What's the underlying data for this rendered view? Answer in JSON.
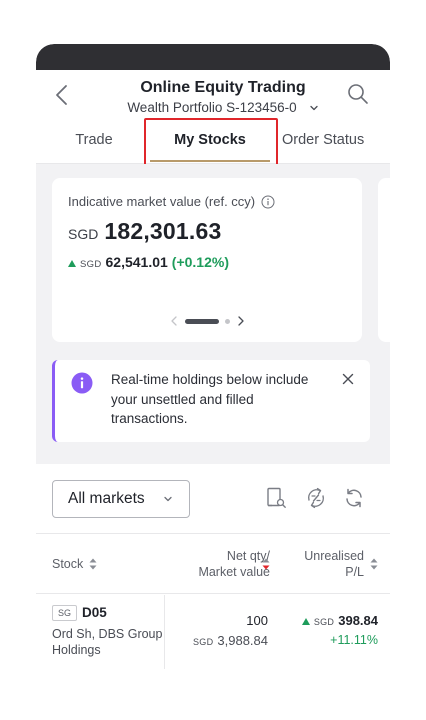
{
  "header": {
    "title": "Online Equity Trading",
    "account": "Wealth Portfolio S-123456-0"
  },
  "tabs": [
    {
      "label": "Trade",
      "active": false
    },
    {
      "label": "My Stocks",
      "active": true
    },
    {
      "label": "Order Status",
      "active": false
    }
  ],
  "market_value": {
    "label": "Indicative market value (ref. ccy)",
    "currency": "SGD",
    "value": "182,301.63",
    "change_currency": "SGD",
    "change": "62,541.01",
    "change_pct": "(+0.12%)",
    "change_direction": "up"
  },
  "notice": {
    "text": "Real-time holdings below include your unsettled and filled transactions.",
    "accent_color": "#8a5cf5"
  },
  "filters": {
    "market": "All markets"
  },
  "table": {
    "headers": {
      "stock": "Stock",
      "net_qty": "Net qty/",
      "market_value": "Market value",
      "unrealised": "Unrealised",
      "pl": "P/L"
    },
    "rows": [
      {
        "market": "SG",
        "symbol": "D05",
        "name": "Ord Sh, DBS Group Holdings",
        "qty": "100",
        "mv_currency": "SGD",
        "market_value": "3,988.84",
        "upl_currency": "SGD",
        "upl": "398.84",
        "upl_pct": "+11.11%",
        "direction": "up"
      }
    ]
  },
  "colors": {
    "positive": "#1e9c5b",
    "tab_underline": "#b89a6a",
    "highlight": "#e0262b"
  }
}
